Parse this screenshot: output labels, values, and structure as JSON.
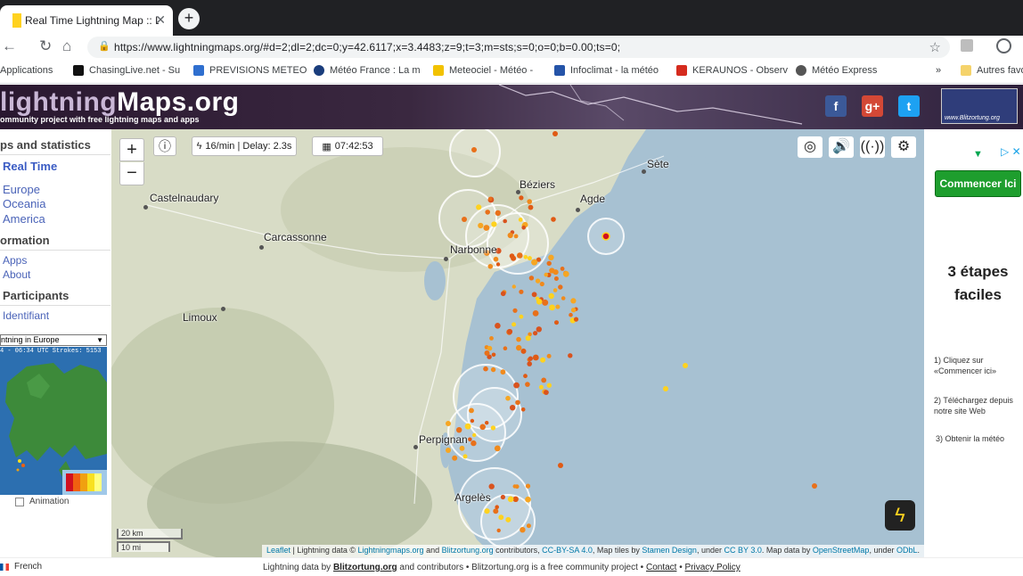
{
  "browser": {
    "tab_title": "Real Time Lightning Map :: Lightn",
    "new_tab": "+",
    "url": "https://www.lightningmaps.org/#d=2;dl=2;dc=0;y=42.6117;x=3.4483;z=9;t=3;m=sts;s=0;o=0;b=0.00;ts=0;",
    "bookmarks": [
      {
        "label": "Applications",
        "color": "#4285f4"
      },
      {
        "label": "ChasingLive.net - Su",
        "color": "#111111"
      },
      {
        "label": "PREVISIONS METEO",
        "color": "#2f6fcf"
      },
      {
        "label": "Météo France : La m",
        "color": "#1a3d7c"
      },
      {
        "label": "Meteociel - Météo -",
        "color": "#f2c200"
      },
      {
        "label": "Infoclimat - la météo",
        "color": "#2554a8"
      },
      {
        "label": "KERAUNOS - Observ",
        "color": "#d52b1e"
      },
      {
        "label": "Météo Express",
        "color": "#555555"
      }
    ],
    "bookmarks_more": "»",
    "other_bookmarks": "Autres favo"
  },
  "site": {
    "logo_part1": "lightning",
    "logo_part2": "Maps.org",
    "tagline": "ommunity project with free lightning maps and apps",
    "blitz_label": "www.Blitzortung.org"
  },
  "sidebar": {
    "maps_heading": "ps and statistics",
    "realtime": "Real Time",
    "regions": [
      "Europe",
      "Oceania",
      "America"
    ],
    "info_heading": "ormation",
    "info_links": [
      "Apps",
      "About"
    ],
    "participants_heading": "Participants",
    "identifiant": "Identifiant",
    "select_value": "ntning in Europe",
    "minimap_stamp": "4 - 06:34 UTC Strokes: 5153",
    "animation_label": "Animation"
  },
  "map": {
    "rate": "16/min | Delay: 2.3s",
    "time": "07:42:53",
    "zoom_in": "+",
    "zoom_out": "−",
    "cities": [
      {
        "name": "Castelnaudary"
      },
      {
        "name": "Carcassonne"
      },
      {
        "name": "Limoux"
      },
      {
        "name": "Béziers"
      },
      {
        "name": "Agde"
      },
      {
        "name": "Sète"
      },
      {
        "name": "Narbonne"
      },
      {
        "name": "Perpignan"
      },
      {
        "name": "Argelès"
      }
    ],
    "scale_km": "20 km",
    "scale_mi": "10 mi",
    "attrib_leaflet": "Leaflet",
    "attrib_1": " | Lightning data © ",
    "attrib_lm": "Lightningmaps.org",
    "attrib_2": " and ",
    "attrib_bo": "Blitzortung.org",
    "attrib_3": " contributors, ",
    "attrib_cc": "CC-BY-SA 4.0",
    "attrib_4": ", Map tiles by ",
    "attrib_stamen": "Stamen Design",
    "attrib_5": ", under ",
    "attrib_ccby": "CC BY 3.0",
    "attrib_6": ". Map data by ",
    "attrib_osm": "OpenStreetMap",
    "attrib_7": ", under ",
    "attrib_odbl": "ODbL",
    "attrib_8": "."
  },
  "ad": {
    "button": "Commencer Ici",
    "headline": "3 étapes faciles",
    "steps": [
      "1) Cliquez sur «Commencer ici»",
      "2) Téléchargez depuis notre site Web",
      "3) Obtenir la météo"
    ]
  },
  "footer": {
    "language": "French",
    "text1": "Lightning data by ",
    "blitz": "Blitzortung.org",
    "text2": " and contributors • Blitzortung.org is a free community project • ",
    "contact": "Contact",
    "sep": " • ",
    "privacy": "Privacy Policy"
  }
}
